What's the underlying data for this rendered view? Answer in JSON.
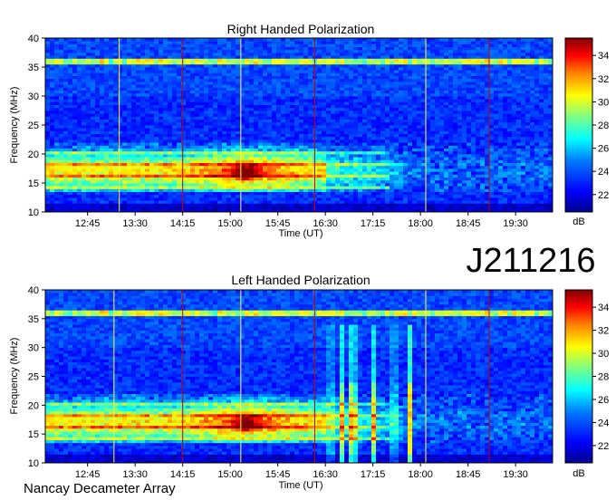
{
  "figure": {
    "observation_id": "J211216",
    "footer": "Nancay Decameter Array"
  },
  "colors": {
    "background": "#ffffff",
    "axis": "#000000",
    "colormap": [
      "#00008f",
      "#0000ff",
      "#0080ff",
      "#00ffff",
      "#80ff80",
      "#ffff00",
      "#ff8000",
      "#ff0000",
      "#800000"
    ]
  },
  "chart_data": [
    {
      "type": "heatmap",
      "title": "Right Handed Polarization",
      "xlabel": "Time (UT)",
      "ylabel": "Frequency (MHz)",
      "x_ticks": [
        "12:45",
        "13:30",
        "14:15",
        "15:00",
        "15:45",
        "16:30",
        "17:15",
        "18:00",
        "18:45",
        "19:30"
      ],
      "y_ticks": [
        10,
        15,
        20,
        25,
        30,
        35,
        40
      ],
      "xlim": [
        "12:05",
        "20:05"
      ],
      "ylim": [
        10,
        40
      ],
      "colorbar": {
        "label": "dB",
        "ticks": [
          22,
          24,
          26,
          28,
          30,
          32,
          34
        ],
        "range": [
          20.5,
          35.5
        ]
      },
      "features": {
        "interference_band_mhz": 36,
        "noise_floor_db": 23,
        "emission_band_mhz": [
          13.5,
          22
        ],
        "emission_peak": {
          "time": "15:15",
          "frequency_mhz": 17,
          "db": 35
        },
        "vertical_lines": [
          "13:15",
          "14:15",
          "15:10",
          "16:20",
          "18:05",
          "19:05"
        ]
      }
    },
    {
      "type": "heatmap",
      "title": "Left Handed Polarization",
      "xlabel": "Time (UT)",
      "ylabel": "Frequency (MHz)",
      "x_ticks": [
        "12:45",
        "13:30",
        "14:15",
        "15:00",
        "15:45",
        "16:30",
        "17:15",
        "18:00",
        "18:45",
        "19:30"
      ],
      "y_ticks": [
        10,
        15,
        20,
        25,
        30,
        35,
        40
      ],
      "xlim": [
        "12:05",
        "20:05"
      ],
      "ylim": [
        10,
        40
      ],
      "colorbar": {
        "label": "dB",
        "ticks": [
          22,
          24,
          26,
          28,
          30,
          32,
          34
        ],
        "range": [
          20.5,
          35.5
        ]
      },
      "features": {
        "interference_band_mhz": 36,
        "noise_floor_db": 23,
        "emission_band_mhz": [
          13.5,
          22
        ],
        "emission_peak": {
          "time": "15:15",
          "frequency_mhz": 17,
          "db": 35
        },
        "vertical_lines": [
          "13:10",
          "14:15",
          "15:10",
          "16:20",
          "18:05",
          "19:05"
        ],
        "bursts": [
          "16:35",
          "16:45",
          "16:55",
          "17:00",
          "17:15",
          "17:35",
          "17:50"
        ]
      }
    }
  ]
}
